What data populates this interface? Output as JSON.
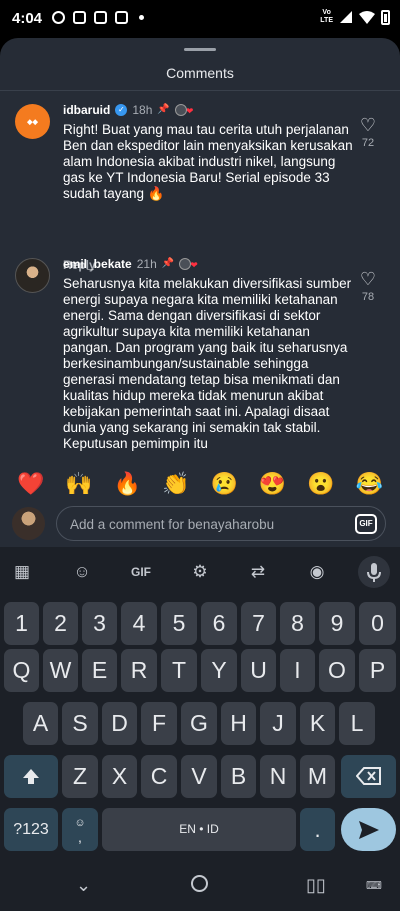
{
  "status": {
    "time": "4:04",
    "network": "Vo\nLTE"
  },
  "sheet": {
    "title": "Comments"
  },
  "comments": [
    {
      "username": "idbaruid",
      "time": "18h",
      "text": "Right! Buat yang mau tau cerita utuh perjalanan Ben dan ekspeditor lain menyaksikan kerusakan alam Indonesia akibat industri nikel, langsung gas ke YT Indonesia Baru! Serial episode 33 sudah tayang 🔥",
      "reply": "Reply",
      "likes": "72"
    },
    {
      "username": "emil_bekate",
      "time": "21h",
      "text": "Seharusnya kita melakukan diversifikasi sumber energi supaya negara kita memiliki ketahanan energi. Sama dengan diversifikasi di sektor agrikultur supaya kita memiliki ketahanan pangan. Dan program yang baik itu seharusnya berkesinambungan/sustainable sehingga generasi mendatang tetap bisa menikmati dan kualitas hidup mereka tidak menurun akibat kebijakan pemerintah saat ini. Apalagi disaat dunia yang sekarang ini semakin tak stabil. Keputusan pemimpin itu",
      "likes": "78"
    }
  ],
  "emojis": [
    "❤️",
    "🙌",
    "🔥",
    "👏",
    "😢",
    "😍",
    "😮",
    "😂"
  ],
  "input": {
    "placeholder": "Add a comment for benayaharobu",
    "gif": "GIF"
  },
  "keyboard": {
    "toolbar": {
      "gif": "GIF"
    },
    "row1": [
      "1",
      "2",
      "3",
      "4",
      "5",
      "6",
      "7",
      "8",
      "9",
      "0"
    ],
    "row2": [
      "Q",
      "W",
      "E",
      "R",
      "T",
      "Y",
      "U",
      "I",
      "O",
      "P"
    ],
    "row3": [
      "A",
      "S",
      "D",
      "F",
      "G",
      "H",
      "J",
      "K",
      "L"
    ],
    "row4": [
      "Z",
      "X",
      "C",
      "V",
      "B",
      "N",
      "M"
    ],
    "symbols": "?123",
    "space": "EN • ID",
    "period": ".",
    "comma": ","
  }
}
